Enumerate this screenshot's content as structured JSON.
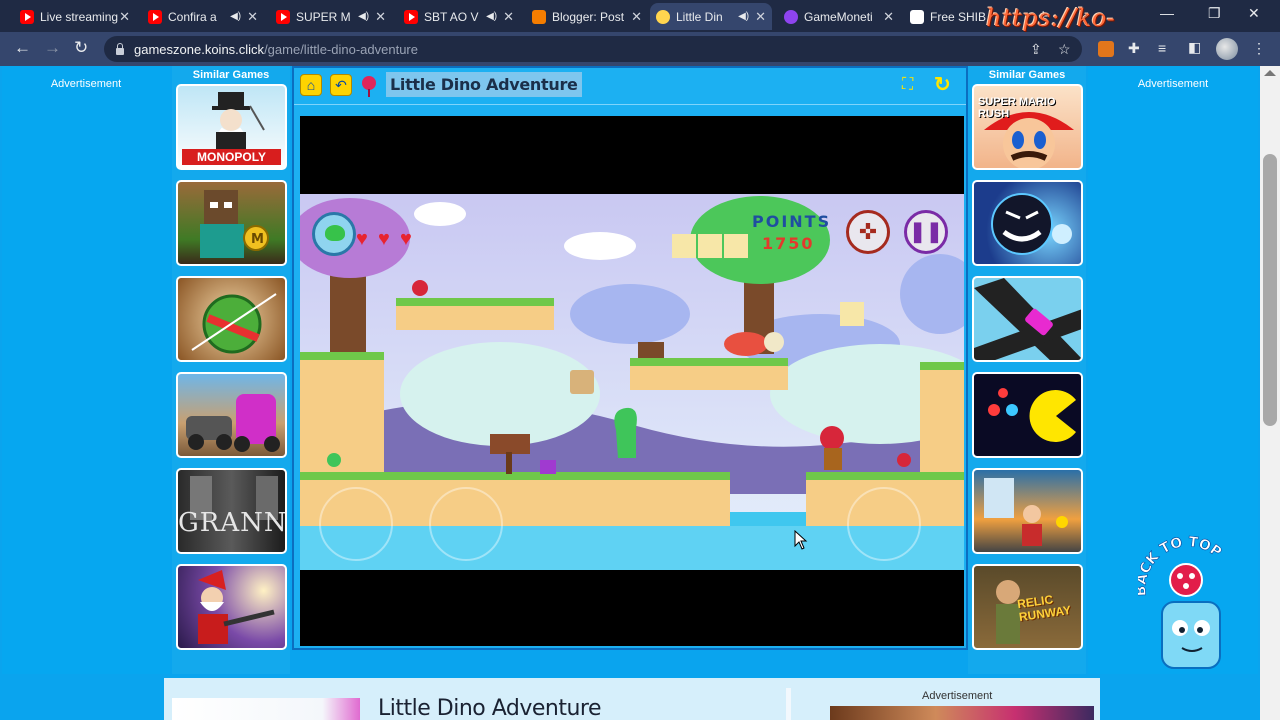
{
  "browser": {
    "tabs": [
      {
        "title": "Live streaming",
        "favicon": "youtube-icon",
        "muted_icon": false
      },
      {
        "title": "Confira a",
        "favicon": "youtube-icon",
        "muted_icon": true
      },
      {
        "title": "SUPER M",
        "favicon": "youtube-icon",
        "muted_icon": true
      },
      {
        "title": "SBT AO V",
        "favicon": "youtube-icon",
        "muted_icon": true
      },
      {
        "title": "Blogger: Post",
        "favicon": "blogger-icon",
        "muted_icon": false
      },
      {
        "title": "Little Din",
        "favicon": "game-icon",
        "muted_icon": true,
        "active": true
      },
      {
        "title": "GameMoneti",
        "favicon": "gamemonetize-icon",
        "muted_icon": false
      },
      {
        "title": "Free SHIB",
        "favicon": "shib-icon",
        "muted_icon": false
      }
    ],
    "new_tab_label": "+",
    "url_host": "gameszone.koins.click",
    "url_path": "/game/little-dino-adventure",
    "watermark": "https://ko-fi.com/gokagen"
  },
  "page": {
    "ad_left_label": "Advertisement",
    "ad_right_label": "Advertisement",
    "similar_left_heading": "Similar Games",
    "similar_right_heading": "Similar Games",
    "left_games": [
      "MONOPOLY",
      "",
      "",
      "",
      "GRANNY",
      ""
    ],
    "right_games": [
      "SUPER MARIO RUSH",
      "",
      "",
      "",
      "",
      "RELIC RUNWAY"
    ],
    "game_title": "Little Dino Adventure",
    "game": {
      "points_label": "POINTS",
      "points_value": "1750",
      "hearts": 3
    },
    "back_to_top": "BACK TO TOP",
    "bottom_title": "Little Dino Adventure",
    "bottom_ad_label": "Advertisement"
  },
  "colors": {
    "page_bg": "#0aa4ee",
    "tab_bar": "#1f2a44",
    "toolbar": "#35466d",
    "accent_yellow": "#ffe500"
  }
}
